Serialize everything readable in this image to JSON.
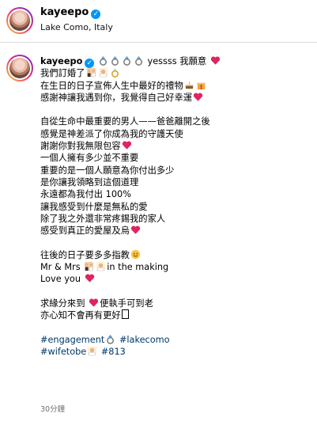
{
  "header": {
    "username": "kayeepo",
    "location": "Lake Como, Italy"
  },
  "post": {
    "username": "kayeepo",
    "first_line_text": "yessss 我願意",
    "lines": [
      "我們訂婚了",
      "在生日的日子宣佈人生中最好的禮物",
      "感謝神讓我遇到你，我覺得自己好幸運",
      "",
      "自從生命中最重要的男人——爸爸離開之後",
      "感覺是神差派了你成為我的守護天使",
      "謝謝你對我無限包容",
      "一個人擁有多少並不重要",
      "重要的是一個人願意為你付出多少",
      "是你讓我領略到這個道理",
      "永遠都為我付出 100%",
      "讓我感受到什麼是無私的愛",
      "除了我之外還非常疼錫我的家人",
      "感受到真正的愛屋及烏",
      "",
      "往後的日子要多多指教",
      "Mr & Mrs",
      "Love you",
      "",
      "求緣分來到",
      "亦心知不會再有更好",
      ""
    ],
    "mr_mrs_suffix": "in the making",
    "love_suffix_text": "便執手可到老",
    "hashtags_line1": [
      "#engagement",
      "#lakecomo"
    ],
    "hashtags_line2": [
      "#wifetobe",
      "#813"
    ],
    "timestamp": "30分鐘"
  },
  "icons": {
    "verified": "verified-badge-icon",
    "ring": "ring-emoji",
    "heart": "red-heart-emoji",
    "couple": "couple-emoji",
    "cake": "cake-emoji",
    "gift": "gift-emoji",
    "smile": "smiling-face-emoji"
  },
  "colors": {
    "verified": "#0095f6",
    "hashtag": "#00376b",
    "heart": "#e0245e"
  }
}
